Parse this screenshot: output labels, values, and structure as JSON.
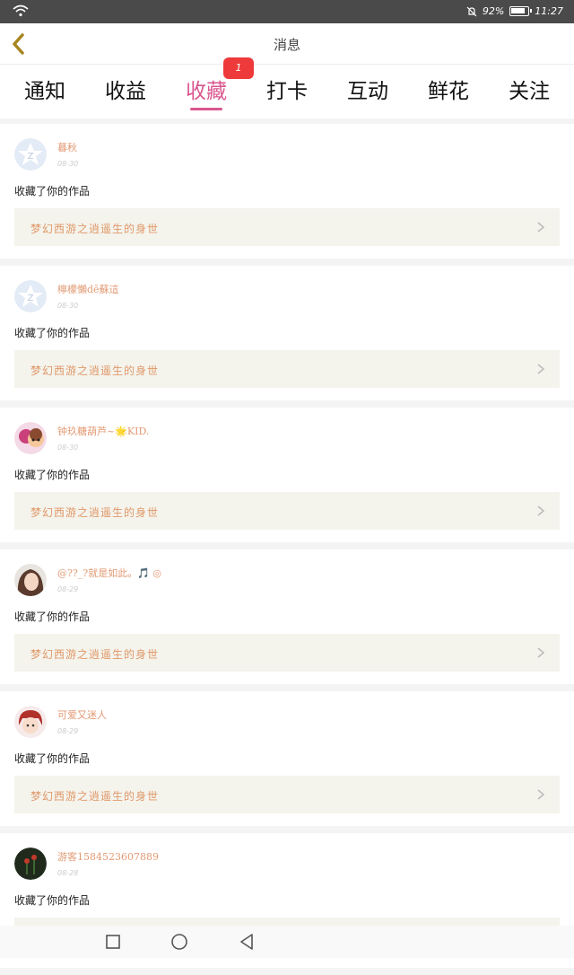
{
  "status_bar": {
    "battery": "92%",
    "time": "11:27"
  },
  "header": {
    "title": "消息"
  },
  "tabs": [
    {
      "label": "通知"
    },
    {
      "label": "收益"
    },
    {
      "label": "收藏"
    },
    {
      "label": "打卡"
    },
    {
      "label": "互动"
    },
    {
      "label": "鲜花"
    },
    {
      "label": "关注"
    }
  ],
  "active_tab": "收藏",
  "badge": {
    "count": "1"
  },
  "colors": {
    "accent": "#d9578e",
    "username": "#e29a74",
    "badge": "#ee3a3a",
    "work_bg": "#f4f3ec"
  },
  "items": [
    {
      "user": "暮秋",
      "date": "08-30",
      "action": "收藏了你的作品",
      "work": "梦幻西游之逍遥生的身世",
      "avatar": "default-avatar"
    },
    {
      "user": "檸檬懶dē蘇這",
      "date": "08-30",
      "action": "收藏了你的作品",
      "work": "梦幻西游之逍遥生的身世",
      "avatar": "default-avatar"
    },
    {
      "user": "钟玖糖葫芦~🌟KID.",
      "date": "08-30",
      "action": "收藏了你的作品",
      "work": "梦幻西游之逍遥生的身世",
      "avatar": "anime-avatar"
    },
    {
      "user": "@??_?就是如此。🎵 ◎",
      "date": "08-29",
      "action": "收藏了你的作品",
      "work": "梦幻西游之逍遥生的身世",
      "avatar": "photo-avatar"
    },
    {
      "user": "可爱又迷人",
      "date": "08-29",
      "action": "收藏了你的作品",
      "work": "梦幻西游之逍遥生的身世",
      "avatar": "anime-avatar"
    },
    {
      "user": "游客1584523607889",
      "date": "08-28",
      "action": "收藏了你的作品",
      "work": "",
      "avatar": "flower-avatar"
    }
  ]
}
